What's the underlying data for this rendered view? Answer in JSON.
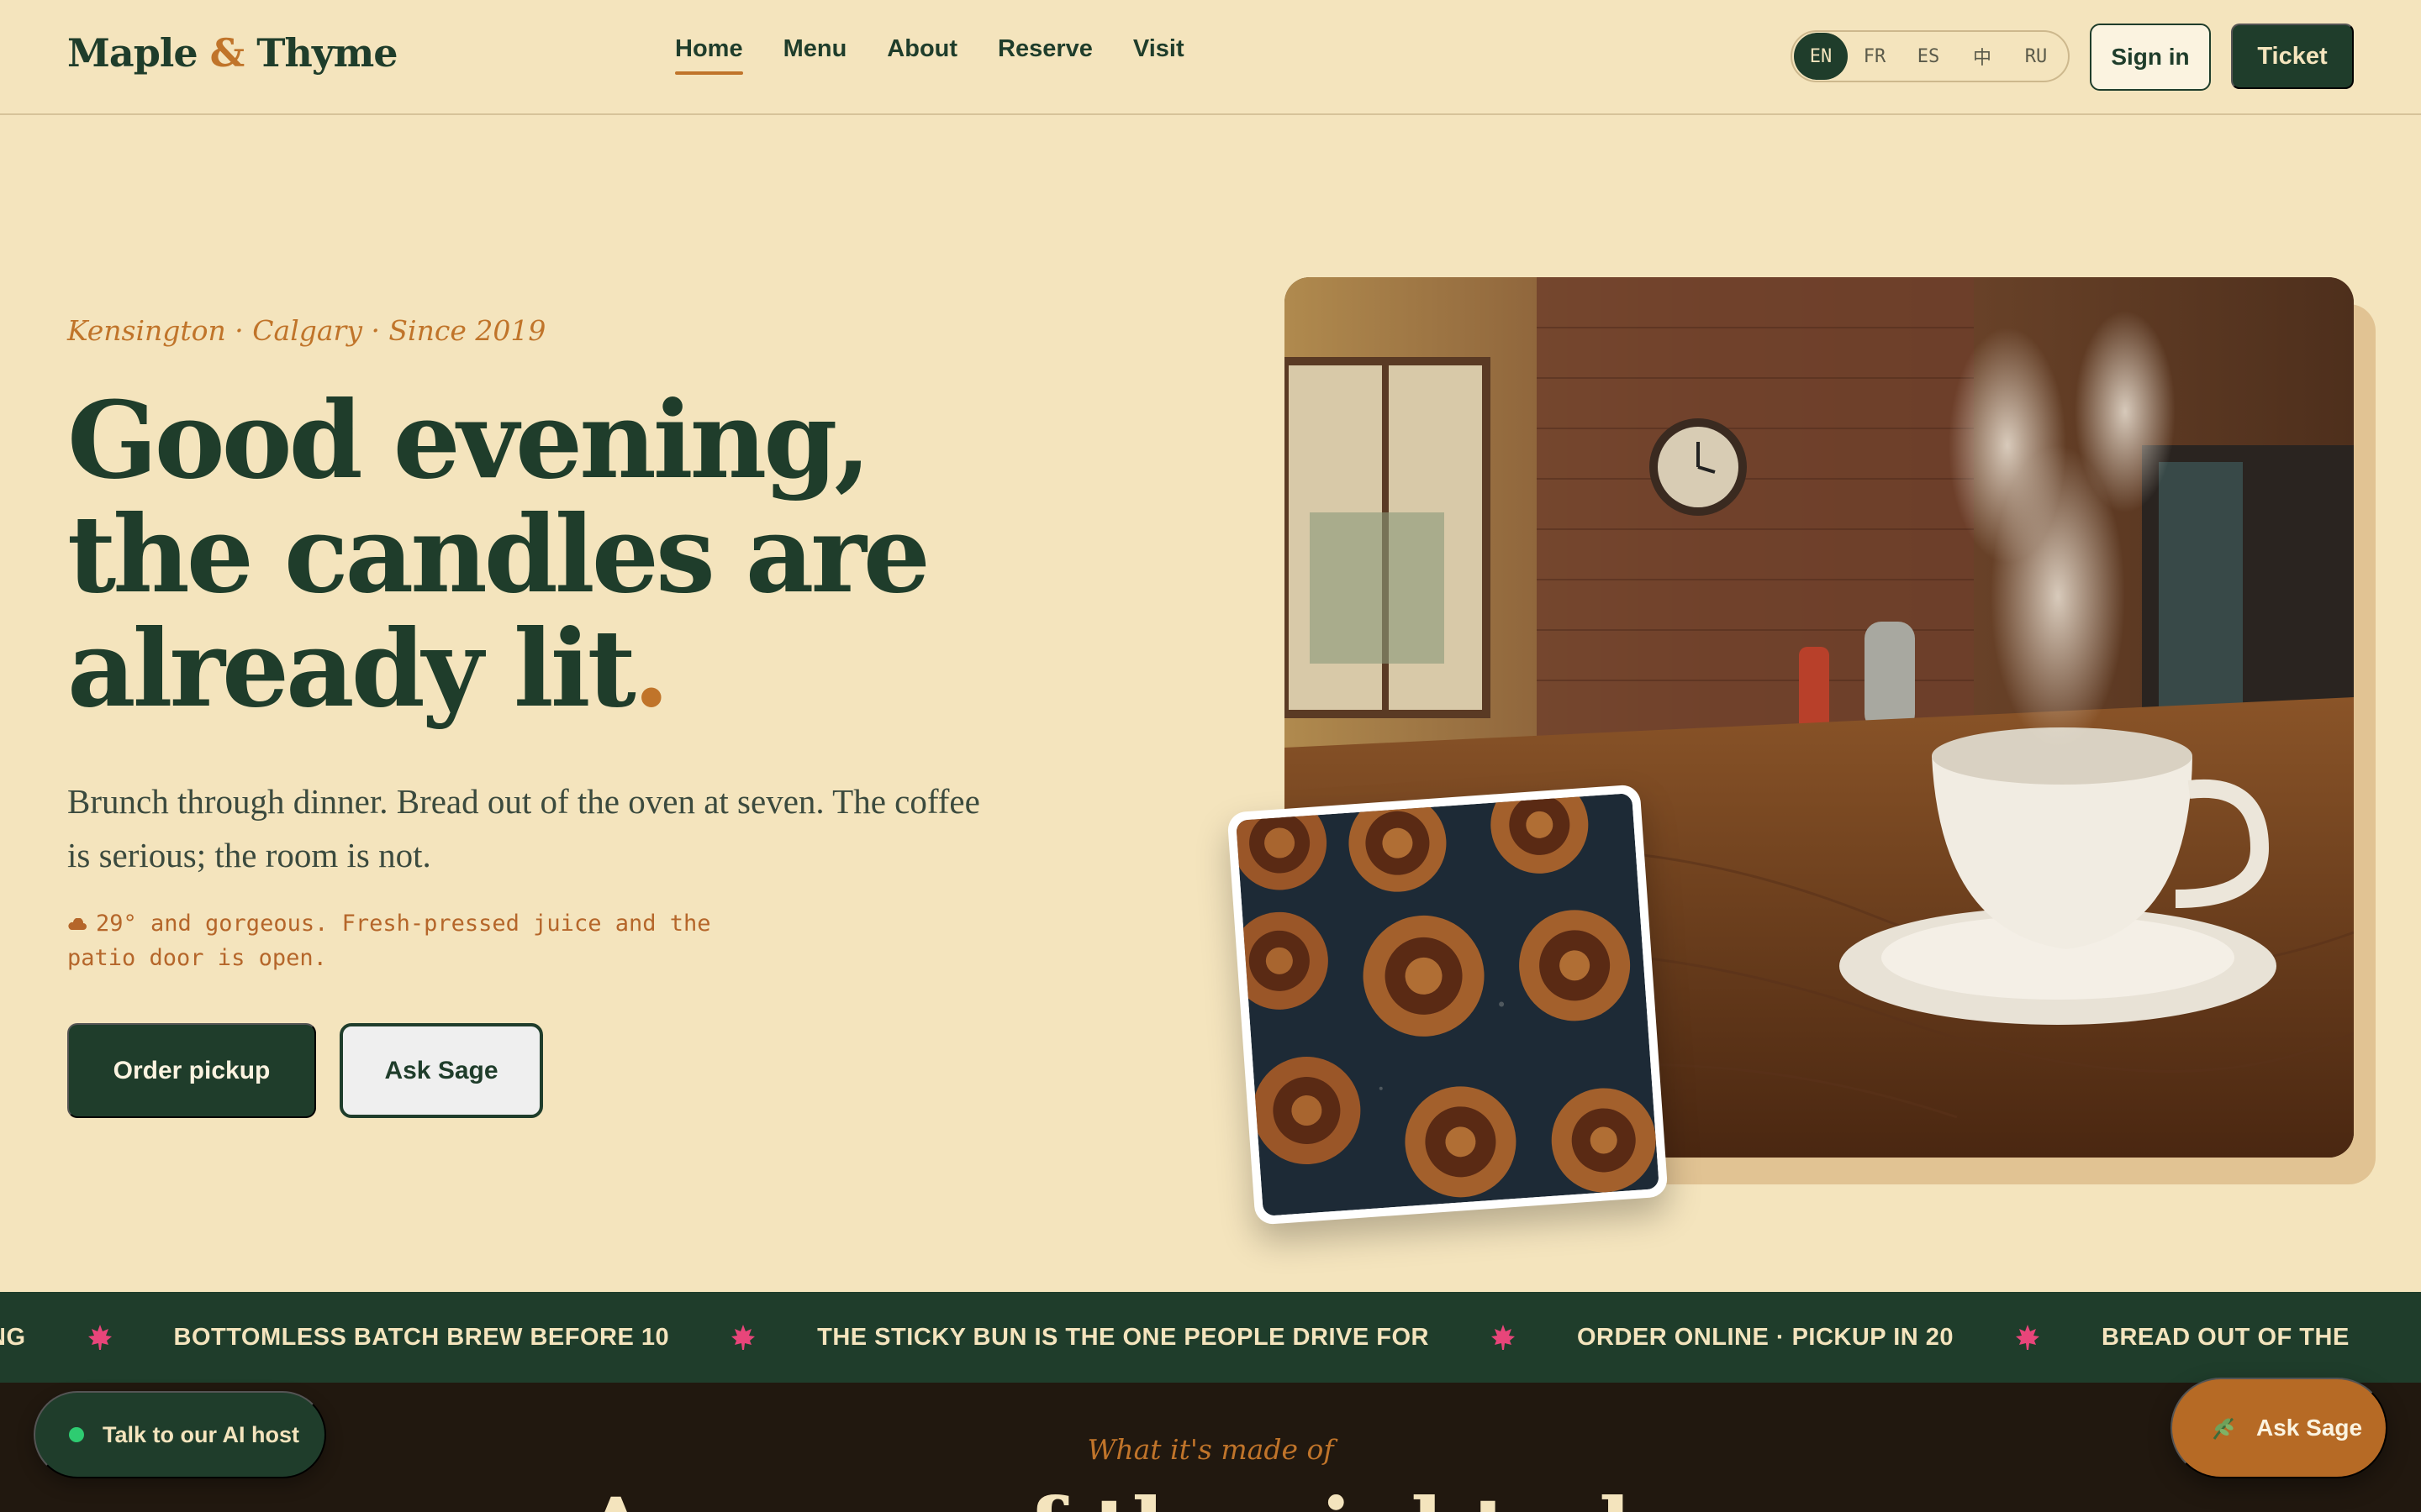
{
  "brand": {
    "name_part1": "Maple",
    "amp": "&",
    "name_part2": "Thyme",
    "colors": {
      "primary": "#1f3d2b",
      "accent": "#c0742a",
      "cream": "#f4e4bd",
      "dark": "#21180f"
    }
  },
  "nav": {
    "items": [
      {
        "label": "Home",
        "active": true
      },
      {
        "label": "Menu"
      },
      {
        "label": "About"
      },
      {
        "label": "Reserve"
      },
      {
        "label": "Visit"
      }
    ]
  },
  "languages": {
    "items": [
      "EN",
      "FR",
      "ES",
      "中",
      "RU"
    ],
    "selected": "EN"
  },
  "header_actions": {
    "signin_label": "Sign in",
    "ticket_label": "Ticket"
  },
  "hero": {
    "eyebrow": "Kensington · Calgary · Since 2019",
    "headline_line1": "Good evening,",
    "headline_line2": "the candles are",
    "headline_line3": "already lit",
    "headline_dot": ".",
    "lead": "Brunch through dinner. Bread out of the oven at seven. The coffee is serious; the room is not.",
    "weather_icon": "cloud-icon",
    "weather_line1": "29° and gorgeous. Fresh-pressed juice and the",
    "weather_line2": "patio door is open.",
    "primary_cta": "Order pickup",
    "secondary_cta": "Ask Sage"
  },
  "ticker": {
    "items": [
      "NG",
      "BOTTOMLESS BATCH BREW BEFORE 10",
      "THE STICKY BUN IS THE ONE PEOPLE DRIVE FOR",
      "ORDER ONLINE · PICKUP IN 20",
      "BREAD OUT OF THE"
    ],
    "separator_icon": "maple-leaf-icon"
  },
  "made_of": {
    "eyebrow": "What it's made of",
    "title": "A menu of the right places"
  },
  "widgets": {
    "ai_host_label": "Talk to our AI host",
    "sage_label": "Ask Sage"
  }
}
